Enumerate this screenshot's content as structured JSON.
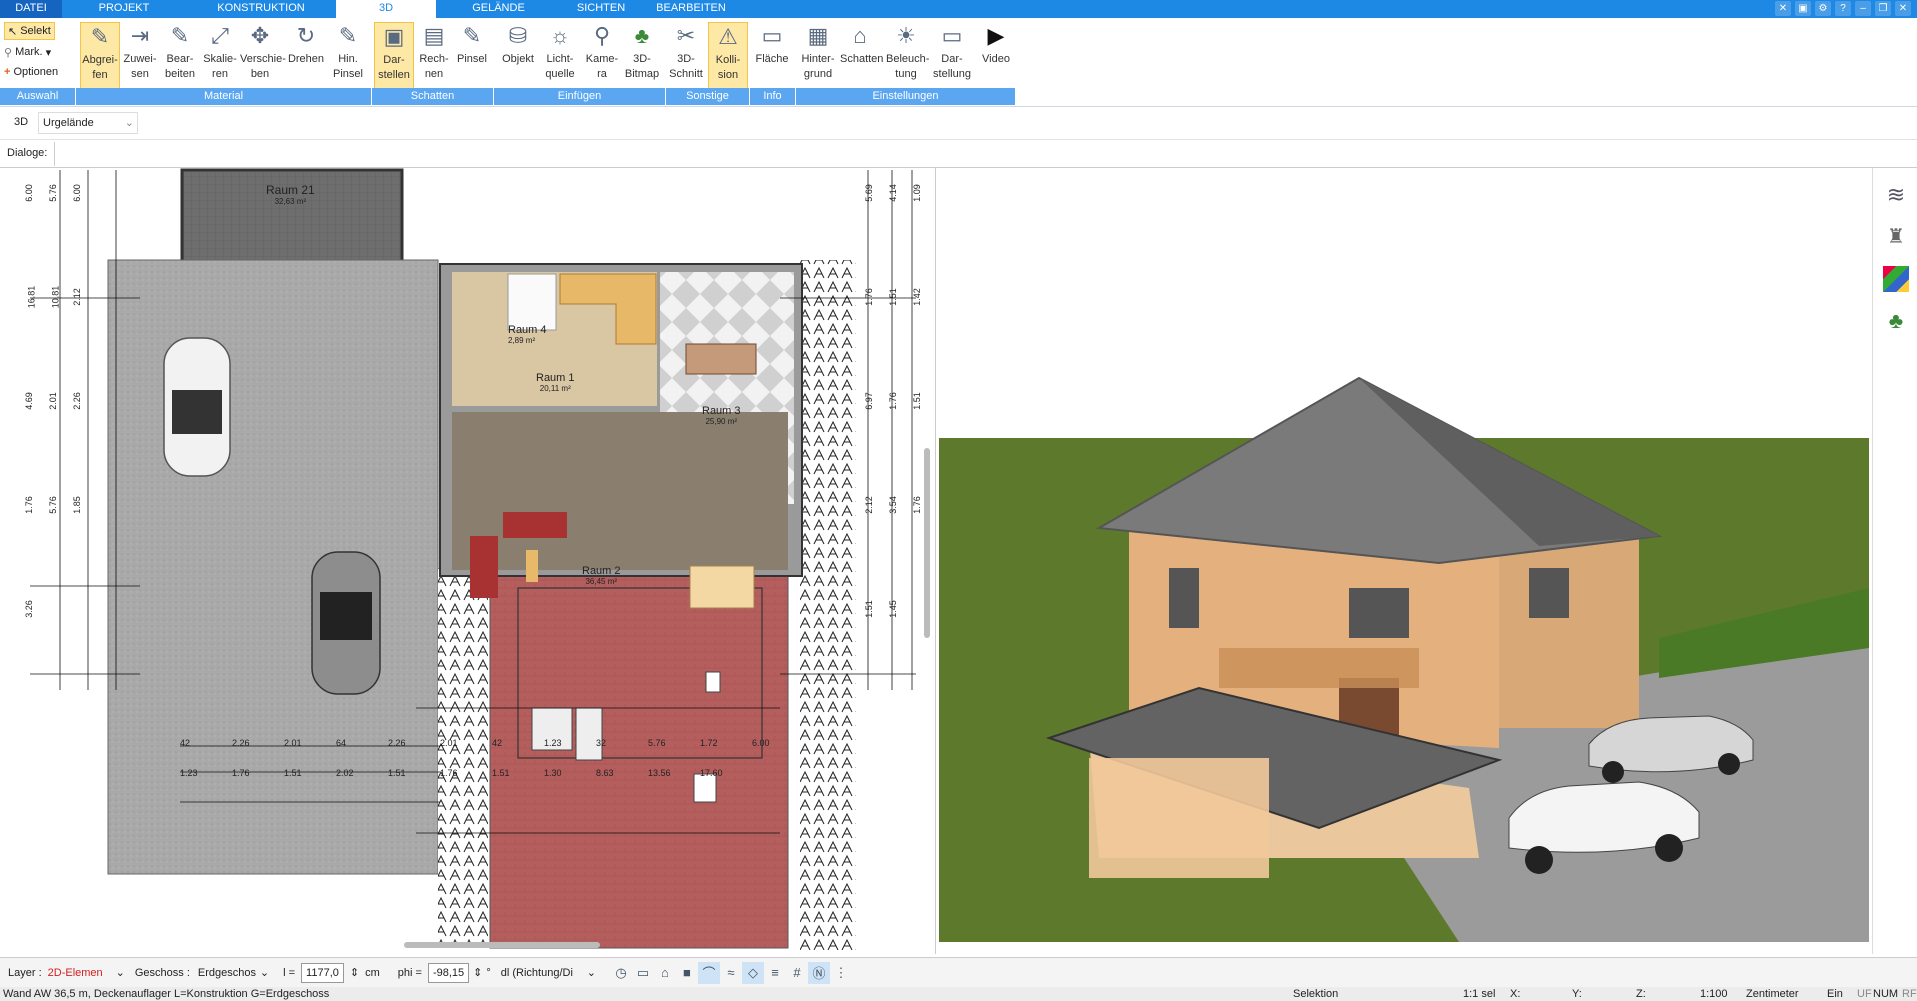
{
  "menu": {
    "tabs": [
      "DATEI",
      "PROJEKT",
      "KONSTRUKTION",
      "3D",
      "GELÄNDE",
      "SICHTEN",
      "BEARBEITEN"
    ]
  },
  "ribbon": {
    "side": {
      "selekt": "Selekt",
      "mark": "Mark.",
      "optionen": "Optionen",
      "group": "Auswahl"
    },
    "buttons": [
      {
        "l1": "Abgrei-",
        "l2": "fen"
      },
      {
        "l1": "Zuwei-",
        "l2": "sen"
      },
      {
        "l1": "Bear-",
        "l2": "beiten"
      },
      {
        "l1": "Skalie-",
        "l2": "ren"
      },
      {
        "l1": "Verschie-",
        "l2": "ben"
      },
      {
        "l1": "Drehen",
        "l2": ""
      },
      {
        "l1": "Hin.",
        "l2": "Pinsel"
      },
      {
        "l1": "Dar-",
        "l2": "stellen"
      },
      {
        "l1": "Rech-",
        "l2": "nen"
      },
      {
        "l1": "Pinsel",
        "l2": ""
      },
      {
        "l1": "Objekt",
        "l2": ""
      },
      {
        "l1": "Licht-",
        "l2": "quelle"
      },
      {
        "l1": "Kame-",
        "l2": "ra"
      },
      {
        "l1": "3D-",
        "l2": "Bitmap"
      },
      {
        "l1": "3D-",
        "l2": "Schnitt"
      },
      {
        "l1": "Kolli-",
        "l2": "sion"
      },
      {
        "l1": "Fläche",
        "l2": ""
      },
      {
        "l1": "Hinter-",
        "l2": "grund"
      },
      {
        "l1": "Schatten",
        "l2": ""
      },
      {
        "l1": "Beleuch-",
        "l2": "tung"
      },
      {
        "l1": "Dar-",
        "l2": "stellung"
      },
      {
        "l1": "Video",
        "l2": ""
      }
    ],
    "groups": [
      "Material",
      "Schatten",
      "Einfügen",
      "Sonstige",
      "Info",
      "Einstellungen"
    ]
  },
  "toolbar2": {
    "mode": "3D",
    "select_value": "Urgelände"
  },
  "dialoge": {
    "label": "Dialoge:"
  },
  "plan": {
    "rooms": [
      {
        "name": "Raum 21",
        "area": "32,63 m²"
      },
      {
        "name": "Raum 4",
        "area": "2,89 m²"
      },
      {
        "name": "Raum 1",
        "area": "20,11 m²"
      },
      {
        "name": "Raum 3",
        "area": "25,90 m²"
      },
      {
        "name": "Raum 2",
        "area": "36,45 m²"
      }
    ],
    "dims_left": [
      "6.00",
      "5.76",
      "6.00",
      "16.81",
      "10.81",
      "2.12",
      "4.69",
      "2.01",
      "2.26",
      "1.76",
      "5.76",
      "1.85",
      "3.26"
    ],
    "dims_right": [
      "5.69",
      "4.14",
      "1.09",
      "1.76",
      "1.51",
      "1.42",
      "6.97",
      "1.76",
      "1.51",
      "2.12",
      "3.54",
      "1.76",
      "1.51",
      "1.45"
    ],
    "dims_bottom": [
      "42",
      "2.26",
      "2.01",
      "64",
      "2.26",
      "2.01",
      "42",
      "1.23",
      "32",
      "5.76",
      "1.72",
      "6.00",
      "1.23",
      "1.76",
      "1.51",
      "2.02",
      "1.51",
      "1.76",
      "1.51",
      "1.30",
      "8.63",
      "13.56",
      "17.60"
    ]
  },
  "bottombar": {
    "layer_label": "Layer :",
    "layer_value": "2D-Elemen",
    "geschoss_label": "Geschoss :",
    "geschoss_value": "Erdgeschos",
    "l_label": "l =",
    "l_value": "1177,0",
    "l_unit": "cm",
    "phi_label": "phi =",
    "phi_value": "-98,15",
    "phi_unit": "°",
    "dl_value": "dl (Richtung/Di"
  },
  "status": {
    "message": "Wand AW 36,5 m, Deckenauflager L=Konstruktion G=Erdgeschoss",
    "selektion": "Selektion",
    "sel": "1:1 sel",
    "x": "X:",
    "y": "Y:",
    "z": "Z:",
    "scale": "1:100",
    "unit": "Zentimeter",
    "ein": "Ein",
    "uf": "UF",
    "num": "NUM",
    "rf": "RF"
  },
  "colors": {
    "accent": "#1e88e5",
    "group_bar": "#5aa6f0",
    "grass": "#5d7a2c",
    "sky": "#ffffff"
  }
}
